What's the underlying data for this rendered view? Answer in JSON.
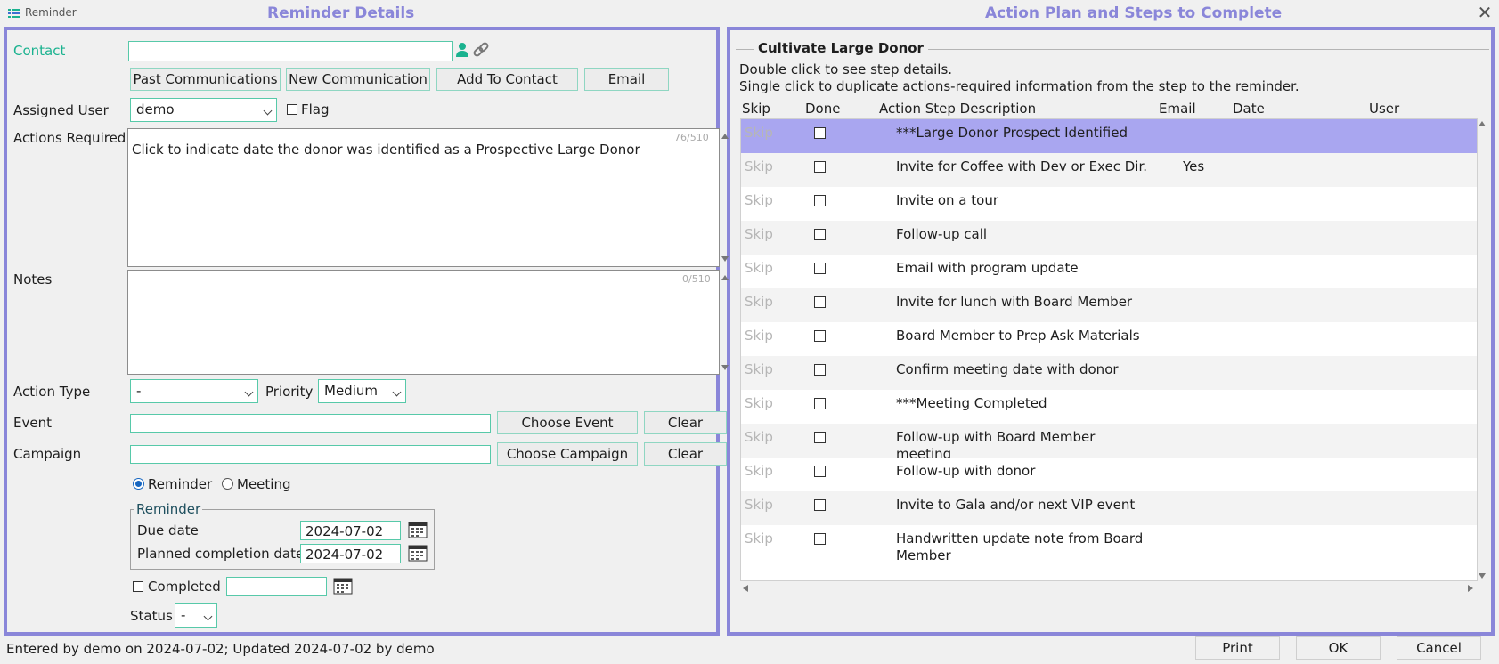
{
  "window": {
    "title": "Reminder"
  },
  "left_panel": {
    "title": "Reminder Details"
  },
  "right_panel": {
    "title": "Action Plan and Steps to Complete"
  },
  "contact": {
    "label": "Contact",
    "value": ""
  },
  "contact_buttons": {
    "past": "Past Communications",
    "new": "New Communication",
    "add": "Add To Contact",
    "email": "Email"
  },
  "assigned_user": {
    "label": "Assigned User",
    "value": "demo",
    "flag_label": "Flag"
  },
  "actions_required": {
    "label": "Actions Required",
    "counter": "76/510",
    "text": "Click to indicate date the donor was identified as a Prospective Large Donor"
  },
  "notes": {
    "label": "Notes",
    "counter": "0/510",
    "text": ""
  },
  "action_type": {
    "label": "Action Type",
    "value": "-"
  },
  "priority": {
    "label": "Priority",
    "value": "Medium"
  },
  "event": {
    "label": "Event",
    "value": "",
    "choose": "Choose Event",
    "clear": "Clear"
  },
  "campaign": {
    "label": "Campaign",
    "value": "",
    "choose": "Choose Campaign",
    "clear": "Clear"
  },
  "mode": {
    "reminder": "Reminder",
    "meeting": "Meeting",
    "selected": "Reminder"
  },
  "reminder_group": {
    "legend": "Reminder",
    "due_label": "Due date",
    "due_value": "2024-07-02",
    "planned_label": "Planned completion date",
    "planned_value": "2024-07-02"
  },
  "completed": {
    "label": "Completed",
    "value": ""
  },
  "status": {
    "label": "Status",
    "value": "-"
  },
  "plan": {
    "name": "Cultivate Large Donor",
    "hint1": "Double click to see step details.",
    "hint2": "Single click to duplicate actions-required information from the step to the reminder.",
    "columns": [
      "Skip",
      "Done",
      "Action Step Description",
      "Email",
      "Date",
      "User"
    ],
    "steps": [
      {
        "skip": "Skip",
        "desc": "***Large Donor Prospect Identified",
        "email": "",
        "selected": true
      },
      {
        "skip": "Skip",
        "desc": "Invite for Coffee with Dev or Exec Dir.",
        "email": "Yes",
        "selected": false
      },
      {
        "skip": "Skip",
        "desc": "Invite on a tour",
        "email": "",
        "selected": false
      },
      {
        "skip": "Skip",
        "desc": "Follow-up call",
        "email": "",
        "selected": false
      },
      {
        "skip": "Skip",
        "desc": "Email with program update",
        "email": "",
        "selected": false
      },
      {
        "skip": "Skip",
        "desc": "Invite for lunch with Board Member",
        "email": "",
        "selected": false
      },
      {
        "skip": "Skip",
        "desc": "Board Member to Prep Ask Materials",
        "email": "",
        "selected": false
      },
      {
        "skip": "Skip",
        "desc": "Confirm meeting date with donor",
        "email": "",
        "selected": false
      },
      {
        "skip": "Skip",
        "desc": "***Meeting Completed",
        "email": "",
        "selected": false
      },
      {
        "skip": "Skip",
        "desc": "Follow-up with Board Member meeting",
        "email": "",
        "selected": false
      },
      {
        "skip": "Skip",
        "desc": "Follow-up with donor",
        "email": "",
        "selected": false
      },
      {
        "skip": "Skip",
        "desc": "Invite to Gala and/or next VIP event",
        "email": "",
        "selected": false
      },
      {
        "skip": "Skip",
        "desc": "Handwritten update note from Board Member",
        "email": "",
        "selected": false
      }
    ]
  },
  "footer": {
    "status_text": "Entered by demo on 2024-07-02; Updated 2024-07-02 by demo",
    "print": "Print",
    "ok": "OK",
    "cancel": "Cancel"
  },
  "colors": {
    "accent": "#8a86d9",
    "field_border": "#57c9a9",
    "selected_row": "#a9a6f0",
    "label_green": "#1ab28f"
  }
}
